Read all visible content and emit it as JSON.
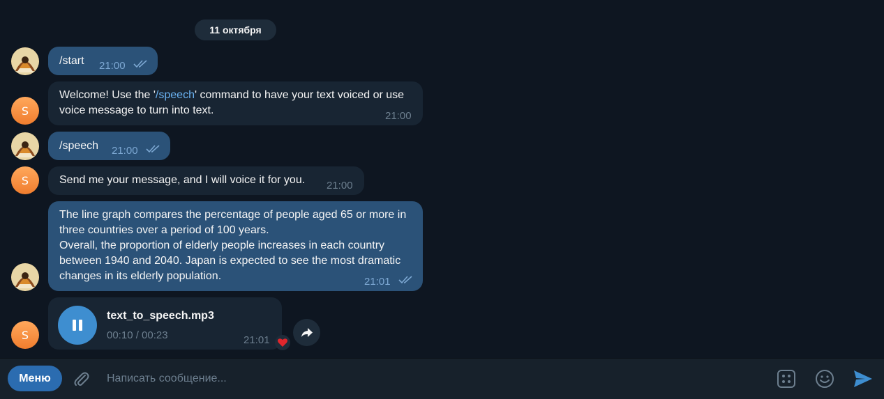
{
  "date_separator": "11 октября",
  "messages": [
    {
      "text": "/start",
      "time": "21:00"
    },
    {
      "text_before": "Welcome! Use the '",
      "command": "/speech",
      "text_after": "' command to have your text voiced or use voice message to turn into text.",
      "time": "21:00",
      "avatar_letter": "S"
    },
    {
      "text": "/speech",
      "time": "21:00"
    },
    {
      "text": "Send me your message, and I will voice it for you.",
      "time": "21:00",
      "avatar_letter": "S"
    },
    {
      "text": "The line graph compares the percentage of people aged 65 or more in three countries over a period of 100 years.\nOverall, the proportion of elderly people increases in each country between 1940 and 2040. Japan is expected to see the most dramatic changes in its elderly population.",
      "time": "21:01"
    },
    {
      "filename": "text_to_speech.mp3",
      "progress": "00:10 / 00:23",
      "time": "21:01",
      "avatar_letter": "S",
      "reaction": "heart"
    }
  ],
  "input": {
    "menu_label": "Меню",
    "placeholder": "Написать сообщение..."
  },
  "colors": {
    "background": "#0e1621",
    "outgoing_bubble": "#2b5278",
    "incoming_bubble": "#182533",
    "accent": "#3e8ed0",
    "command_link": "#6ab2f2"
  },
  "icons": [
    "double-check-icon",
    "pause-icon",
    "share-icon",
    "heart-icon",
    "attach-icon",
    "bot-commands-icon",
    "emoji-icon",
    "send-icon"
  ]
}
